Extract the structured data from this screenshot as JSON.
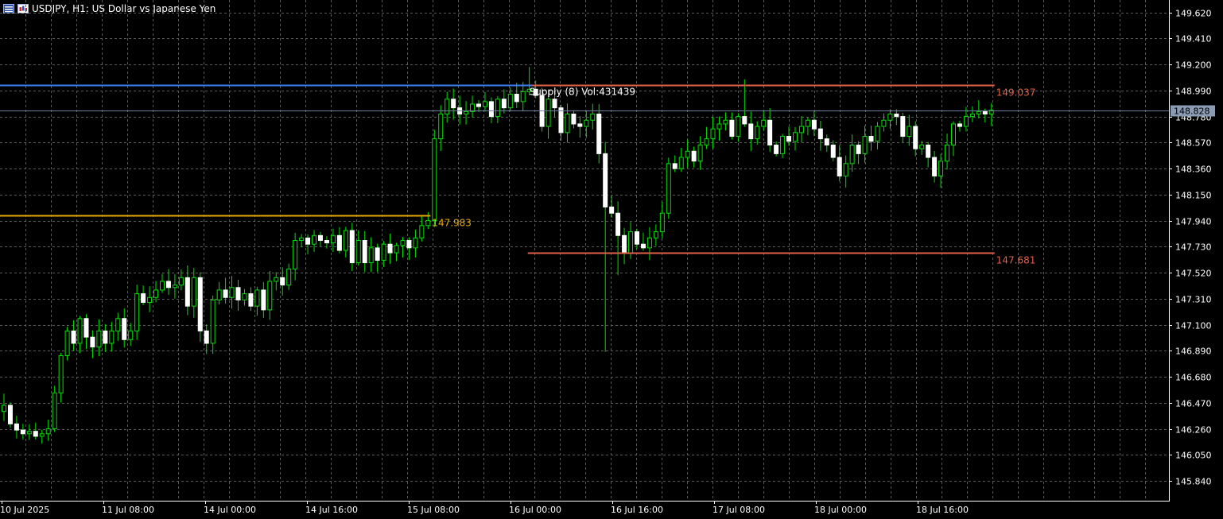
{
  "header": {
    "symbol_title": "USDJPY, H1:  US Dollar vs Japanese Yen"
  },
  "colors": {
    "background": "#000000",
    "grid": "#5a5a5a",
    "bull_candle": "#ffffff",
    "wick": "#00e000",
    "blue_line": "#3c7ef0",
    "orange_line": "#e6a800",
    "supply_line": "#e0604a",
    "current_price_line": "#6a7f99"
  },
  "chart_data": {
    "type": "candlestick",
    "title": "USDJPY, H1:  US Dollar vs Japanese Yen",
    "ylim": [
      145.68,
      149.72
    ],
    "grid": true,
    "y_ticks": [
      "149.620",
      "149.410",
      "149.200",
      "148.990",
      "148.780",
      "148.570",
      "148.360",
      "148.150",
      "147.940",
      "147.730",
      "147.520",
      "147.310",
      "147.100",
      "146.890",
      "146.680",
      "146.470",
      "146.260",
      "146.050",
      "145.840"
    ],
    "x_ticks": [
      "10 Jul 2025",
      "11 Jul 08:00",
      "14 Jul 00:00",
      "14 Jul 16:00",
      "15 Jul 08:00",
      "16 Jul 00:00",
      "16 Jul 16:00",
      "17 Jul 08:00",
      "18 Jul 00:00",
      "18 Jul 16:00"
    ],
    "current_price": "148.828",
    "price_levels": [
      {
        "value": 149.037,
        "label": "149.037",
        "color": "supply_line",
        "start_bar": 83,
        "annotation": "Supply (8) Vol:431439"
      },
      {
        "value": 147.681,
        "label": "147.681",
        "color": "supply_line",
        "start_bar": 83,
        "annotation": ""
      },
      {
        "value": 147.983,
        "label": "147.983",
        "color": "orange_line",
        "start_bar": 0,
        "end_bar": 67,
        "annotation": ""
      },
      {
        "value": 149.037,
        "label": "",
        "color": "blue_line",
        "start_bar": 0,
        "end_bar": 83,
        "annotation": ""
      }
    ],
    "closes": [
      146.45,
      146.3,
      146.25,
      146.22,
      146.24,
      146.2,
      146.22,
      146.26,
      146.55,
      146.85,
      147.05,
      146.95,
      147.15,
      147.0,
      146.92,
      147.05,
      146.95,
      147.05,
      147.15,
      146.98,
      147.05,
      147.35,
      147.28,
      147.32,
      147.38,
      147.45,
      147.4,
      147.42,
      147.48,
      147.25,
      147.48,
      147.05,
      146.95,
      147.3,
      147.38,
      147.32,
      147.4,
      147.3,
      147.35,
      147.25,
      147.38,
      147.22,
      147.45,
      147.48,
      147.42,
      147.55,
      147.78,
      147.8,
      147.75,
      147.82,
      147.78,
      147.76,
      147.82,
      147.7,
      147.86,
      147.6,
      147.78,
      147.6,
      147.72,
      147.62,
      147.75,
      147.68,
      147.74,
      147.78,
      147.72,
      147.8,
      147.9,
      147.94,
      148.6,
      148.8,
      148.92,
      148.85,
      148.8,
      148.82,
      148.88,
      148.86,
      148.9,
      148.78,
      148.92,
      148.85,
      148.96,
      148.9,
      148.98,
      149.0,
      148.95,
      148.7,
      148.92,
      148.85,
      148.65,
      148.8,
      148.72,
      148.7,
      148.75,
      148.8,
      148.48,
      148.05,
      148.0,
      147.82,
      147.68,
      147.85,
      147.75,
      147.72,
      147.8,
      147.85,
      148.0,
      148.4,
      148.36,
      148.45,
      148.5,
      148.42,
      148.55,
      148.6,
      148.68,
      148.72,
      148.75,
      148.62,
      148.78,
      148.72,
      148.6,
      148.7,
      148.75,
      148.55,
      148.48,
      148.62,
      148.58,
      148.65,
      148.7,
      148.75,
      148.68,
      148.6,
      148.55,
      148.45,
      148.3,
      148.4,
      148.55,
      148.48,
      148.62,
      148.58,
      148.7,
      148.75,
      148.8,
      148.78,
      148.62,
      148.7,
      148.52,
      148.55,
      148.45,
      148.3,
      148.42,
      148.55,
      148.72,
      148.7,
      148.78,
      148.8,
      148.82,
      148.8,
      148.83
    ]
  }
}
